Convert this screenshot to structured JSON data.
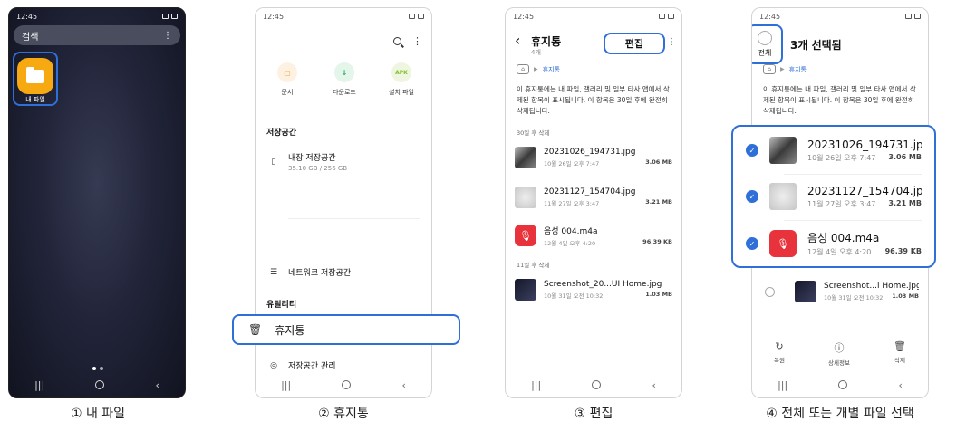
{
  "status": {
    "time": "12:45"
  },
  "nav": {
    "recents": "|||",
    "back": "‹"
  },
  "screen1": {
    "search_label": "검색",
    "menu": "⋮",
    "app_label": "내 파일",
    "caption": "① 내 파일"
  },
  "screen2": {
    "menu": "⋮",
    "categories": [
      {
        "label": "문서",
        "color": "#f5a23a",
        "bg": "#fdf1e2",
        "glyph": "▢"
      },
      {
        "label": "다운로드",
        "color": "#2fa86a",
        "bg": "#e4f5ea",
        "glyph": "↓"
      },
      {
        "label": "설치 파일",
        "color": "#7fbf2f",
        "bg": "#eef6df",
        "glyph": "APK"
      }
    ],
    "storage_header": "저장공간",
    "internal_name": "내장 저장공간",
    "internal_size": "35.10 GB / 256 GB",
    "network": "네트워크 저장공간",
    "utility_header": "유틸리티",
    "trash": "휴지통",
    "storage_manage": "저장공간 관리",
    "caption": "② 휴지통"
  },
  "screen3": {
    "back": "‹",
    "title": "휴지통",
    "count": "4개",
    "edit": "편집",
    "menu": "⋮",
    "crumb": "휴지통",
    "note": "이 휴지통에는 내 파일, 갤러리 및 일부 타사 앱에서 삭제된 항목이 표시됩니다. 이 항목은 30일 후에 완전히 삭제됩니다.",
    "group1": "30일 후 삭제",
    "group2": "11일 후 삭제",
    "files": [
      {
        "name": "20231026_194731.jpg",
        "date": "10월 26일 오후 7:47",
        "size": "3.06 MB",
        "thumb": "photo"
      },
      {
        "name": "20231127_154704.jpg",
        "date": "11월 27일 오후 3:47",
        "size": "3.21 MB",
        "thumb": "blur"
      },
      {
        "name": "음성 004.m4a",
        "date": "12월 4일 오후 4:20",
        "size": "96.39 KB",
        "thumb": "rec"
      },
      {
        "name": "Screenshot_20...UI Home.jpg",
        "date": "10월 31일 오전 10:32",
        "size": "1.03 MB",
        "thumb": "shot"
      }
    ],
    "caption": "③ 편집"
  },
  "screen4": {
    "all_label": "전체",
    "selected_title": "3개 선택됨",
    "crumb": "휴지통",
    "note": "이 휴지통에는 내 파일, 갤러리 및 일부 타사 앱에서 삭제된 항목이 표시됩니다. 이 항목은 30일 후에 완전히 삭제됩니다.",
    "last_file": {
      "name": "Screenshot...l Home.jpg",
      "date": "10월 31일 오전 10:32",
      "size": "1.03 MB"
    },
    "actions": [
      {
        "label": "복원",
        "glyph": "↻"
      },
      {
        "label": "상세정보",
        "glyph": "ⓘ"
      },
      {
        "label": "삭제",
        "glyph": "🗑"
      }
    ],
    "caption": "④ 전체 또는 개별 파일 선택"
  }
}
